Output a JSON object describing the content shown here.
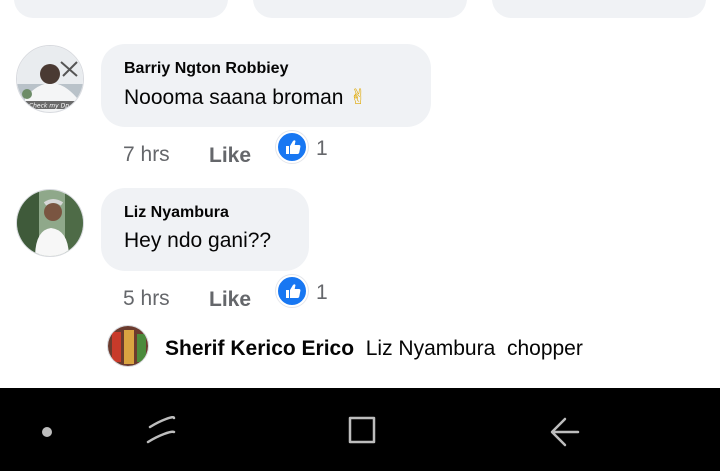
{
  "comments": [
    {
      "author": "Barriy Ngton Robbiey",
      "text": "Noooma saana broman",
      "emoji": "✌",
      "time": "7 hrs",
      "like_label": "Like",
      "reaction_count": "1"
    },
    {
      "author": "Liz Nyambura",
      "text": "Hey ndo gani??",
      "time": "5 hrs",
      "like_label": "Like",
      "reaction_count": "1"
    }
  ],
  "reply_preview": {
    "author": "Sherif Kerico Erico",
    "mention": "Liz Nyambura",
    "text": "chopper"
  },
  "avatar_caption": "Check my Dp",
  "colors": {
    "bubble": "#f0f2f5",
    "reaction_blue": "#1877f2",
    "meta_gray": "#65676b",
    "navbar": "#000000"
  },
  "icons": {
    "reaction": "like-thumb-icon",
    "nav": [
      "dot-icon",
      "recent-apps-icon",
      "home-icon",
      "back-icon"
    ]
  }
}
